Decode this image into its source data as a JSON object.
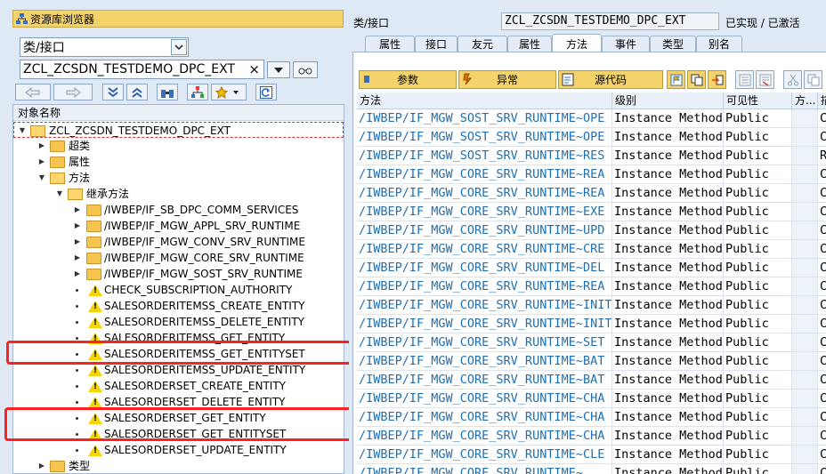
{
  "left": {
    "header_title": "资源库浏览器",
    "type_select": "类/接口",
    "name_input": "ZCL_ZCSDN_TESTDEMO_DPC_EXT",
    "clear_glyph": "×",
    "tree_header": "对象名称",
    "tree": {
      "root": "ZCL_ZCSDN_TESTDEMO_DPC_EXT",
      "superclass": "超类",
      "attributes": "属性",
      "methods": "方法",
      "inherited_methods": "继承方法",
      "interfaces": [
        "/IWBEP/IF_SB_DPC_COMM_SERVICES",
        "/IWBEP/IF_MGW_APPL_SRV_RUNTIME",
        "/IWBEP/IF_MGW_CONV_SRV_RUNTIME",
        "/IWBEP/IF_MGW_CORE_SRV_RUNTIME",
        "/IWBEP/IF_MGW_SOST_SRV_RUNTIME"
      ],
      "method_items": [
        "CHECK_SUBSCRIPTION_AUTHORITY",
        "SALESORDERITEMSS_CREATE_ENTITY",
        "SALESORDERITEMSS_DELETE_ENTITY",
        "SALESORDERITEMSS_GET_ENTITY",
        "SALESORDERITEMSS_GET_ENTITYSET",
        "SALESORDERITEMSS_UPDATE_ENTITY",
        "SALESORDERSET_CREATE_ENTITY",
        "SALESORDERSET_DELETE_ENTITY",
        "SALESORDERSET_GET_ENTITY",
        "SALESORDERSET_GET_ENTITYSET",
        "SALESORDERSET_UPDATE_ENTITY"
      ],
      "types": "类型"
    }
  },
  "right": {
    "class_label": "类/接口",
    "class_value": "ZCL_ZCSDN_TESTDEMO_DPC_EXT",
    "class_status": "已实现 / 已激活",
    "tabs": [
      "属性",
      "接口",
      "友元",
      "属性",
      "方法",
      "事件",
      "类型",
      "别名"
    ],
    "active_tab": "方法",
    "toolbar": {
      "params": "参数",
      "exceptions": "异常",
      "source": "源代码"
    },
    "columns": [
      "方法",
      "级别",
      "可见性",
      "方...",
      "描"
    ],
    "rows": [
      {
        "method": "/IWBEP/IF_MGW_SOST_SRV_RUNTIME~OPE",
        "level": "Instance Method",
        "vis": "Public",
        "desc": "Ca"
      },
      {
        "method": "/IWBEP/IF_MGW_SOST_SRV_RUNTIME~OPE",
        "level": "Instance Method",
        "vis": "Public",
        "desc": "Ca"
      },
      {
        "method": "/IWBEP/IF_MGW_SOST_SRV_RUNTIME~RES",
        "level": "Instance Method",
        "vis": "Public",
        "desc": "Re"
      },
      {
        "method": "/IWBEP/IF_MGW_CORE_SRV_RUNTIME~REA",
        "level": "Instance Method",
        "vis": "Public",
        "desc": "Co"
      },
      {
        "method": "/IWBEP/IF_MGW_CORE_SRV_RUNTIME~REA",
        "level": "Instance Method",
        "vis": "Public",
        "desc": "Co"
      },
      {
        "method": "/IWBEP/IF_MGW_CORE_SRV_RUNTIME~EXE",
        "level": "Instance Method",
        "vis": "Public",
        "desc": "Co"
      },
      {
        "method": "/IWBEP/IF_MGW_CORE_SRV_RUNTIME~UPD",
        "level": "Instance Method",
        "vis": "Public",
        "desc": "Co"
      },
      {
        "method": "/IWBEP/IF_MGW_CORE_SRV_RUNTIME~CRE",
        "level": "Instance Method",
        "vis": "Public",
        "desc": "Co"
      },
      {
        "method": "/IWBEP/IF_MGW_CORE_SRV_RUNTIME~DEL",
        "level": "Instance Method",
        "vis": "Public",
        "desc": "Co"
      },
      {
        "method": "/IWBEP/IF_MGW_CORE_SRV_RUNTIME~REA",
        "level": "Instance Method",
        "vis": "Public",
        "desc": "Co"
      },
      {
        "method": "/IWBEP/IF_MGW_CORE_SRV_RUNTIME~INIT",
        "level": "Instance Method",
        "vis": "Public",
        "desc": "Co"
      },
      {
        "method": "/IWBEP/IF_MGW_CORE_SRV_RUNTIME~INIT",
        "level": "Instance Method",
        "vis": "Public",
        "desc": "Co"
      },
      {
        "method": "/IWBEP/IF_MGW_CORE_SRV_RUNTIME~SET",
        "level": "Instance Method",
        "vis": "Public",
        "desc": "Co"
      },
      {
        "method": "/IWBEP/IF_MGW_CORE_SRV_RUNTIME~BAT",
        "level": "Instance Method",
        "vis": "Public",
        "desc": "Co"
      },
      {
        "method": "/IWBEP/IF_MGW_CORE_SRV_RUNTIME~BAT",
        "level": "Instance Method",
        "vis": "Public",
        "desc": "Co"
      },
      {
        "method": "/IWBEP/IF_MGW_CORE_SRV_RUNTIME~CHA",
        "level": "Instance Method",
        "vis": "Public",
        "desc": "Co"
      },
      {
        "method": "/IWBEP/IF_MGW_CORE_SRV_RUNTIME~CHA",
        "level": "Instance Method",
        "vis": "Public",
        "desc": "Co"
      },
      {
        "method": "/IWBEP/IF_MGW_CORE_SRV_RUNTIME~CHA",
        "level": "Instance Method",
        "vis": "Public",
        "desc": "Co"
      },
      {
        "method": "/IWBEP/IF_MGW_CORE_SRV_RUNTIME~CLE",
        "level": "Instance Method",
        "vis": "Public",
        "desc": "Co"
      },
      {
        "method": "/IWBEP/IF_MGW_CORE_SRV_RUNTIME~",
        "level": "Instance Method",
        "vis": "Public",
        "desc": "Co"
      }
    ]
  }
}
